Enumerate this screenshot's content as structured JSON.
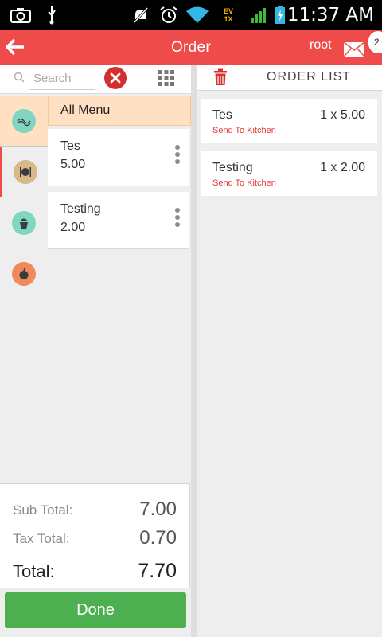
{
  "status_bar": {
    "time": "11:37 AM",
    "icons": [
      "screenshot-icon",
      "usb-icon",
      "mute-icon",
      "alarm-icon",
      "wifi-icon",
      "signal-icon",
      "signal-icon",
      "battery-charging-icon"
    ],
    "network_labels": [
      "EV",
      "1X"
    ]
  },
  "appbar": {
    "title": "Order",
    "user": "root",
    "notification_count": "2",
    "color": "#f04b4b"
  },
  "search": {
    "placeholder": "Search",
    "value": ""
  },
  "categories": [
    {
      "icon": "noodles-icon",
      "color": "#7fd6c1",
      "selected": true
    },
    {
      "icon": "cutlery-icon",
      "color": "#d9b889",
      "selected": false
    },
    {
      "icon": "cupcake-icon",
      "color": "#7fd6c1",
      "selected": false
    },
    {
      "icon": "apple-icon",
      "color": "#f08a5d",
      "selected": false
    }
  ],
  "menu": {
    "all_label": "All Menu",
    "items": [
      {
        "name": "Tes",
        "price": "5.00"
      },
      {
        "name": "Testing",
        "price": "2.00"
      }
    ]
  },
  "totals": {
    "sub_total_label": "Sub Total:",
    "sub_total": "7.00",
    "tax_total_label": "Tax Total:",
    "tax_total": "0.70",
    "total_label": "Total:",
    "total": "7.70"
  },
  "done_label": "Done",
  "order": {
    "title": "ORDER LIST",
    "items": [
      {
        "name": "Tes",
        "qty": "1 x 5.00",
        "status": "Send To Kitchen"
      },
      {
        "name": "Testing",
        "qty": "1 x 2.00",
        "status": "Send To Kitchen"
      }
    ]
  },
  "colors": {
    "accent": "#f04b4b",
    "done": "#4caf50",
    "peach": "#ffe0c2",
    "status_red": "#e53935"
  }
}
